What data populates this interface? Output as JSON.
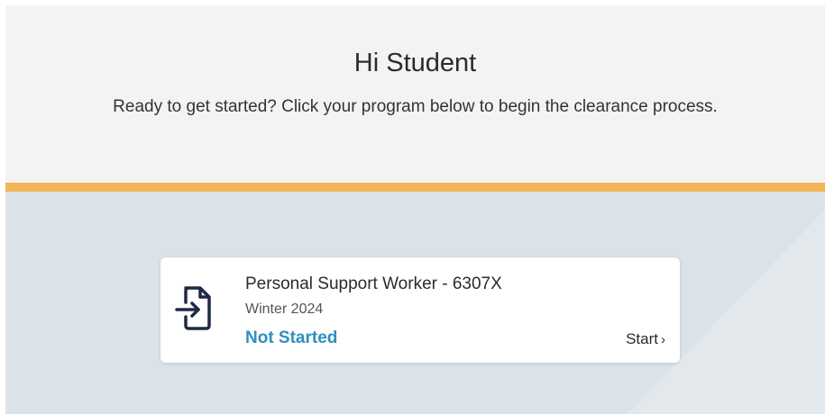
{
  "header": {
    "greeting": "Hi Student",
    "subtitle": "Ready to get started? Click your program below to begin the clearance process."
  },
  "program_card": {
    "name": "Personal Support Worker - 6307X",
    "term": "Winter 2024",
    "status": "Not Started",
    "action_label": "Start",
    "action_chevron": "›",
    "icon": "file-import-icon"
  },
  "colors": {
    "header_bg": "#f3f3f3",
    "accent_bar": "#f0b657",
    "content_bg": "#dbe3e8",
    "status": "#2f8fc0",
    "icon": "#1f2a44"
  }
}
